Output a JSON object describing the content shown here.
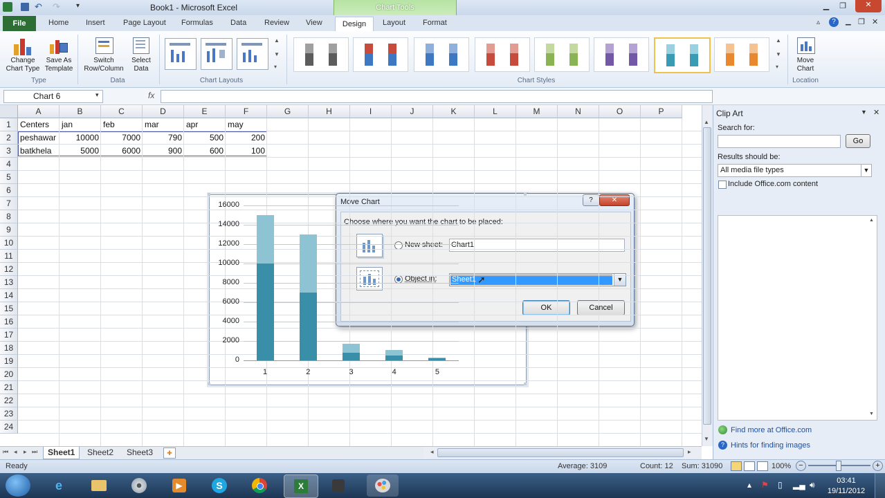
{
  "window": {
    "title": "Book1 - Microsoft Excel",
    "chart_tools_label": "Chart Tools",
    "controls": {
      "minimize": "▁",
      "maximize": "❐",
      "close": "✕"
    }
  },
  "tabs": [
    "File",
    "Home",
    "Insert",
    "Page Layout",
    "Formulas",
    "Data",
    "Review",
    "View",
    "Design",
    "Layout",
    "Format"
  ],
  "ribbon": {
    "type_group": {
      "label": "Type",
      "change_chart_type": "Change Chart Type",
      "save_as_template": "Save As Template"
    },
    "data_group": {
      "label": "Data",
      "switch_row_column": "Switch Row/Column",
      "select_data": "Select Data"
    },
    "layouts_group": {
      "label": "Chart Layouts"
    },
    "styles_group": {
      "label": "Chart Styles"
    },
    "location_group": {
      "label": "Location",
      "move_chart": "Move Chart"
    }
  },
  "formula_bar": {
    "name_box": "Chart 6",
    "fx": "fx",
    "value": ""
  },
  "columns": [
    "A",
    "B",
    "C",
    "D",
    "E",
    "F",
    "G",
    "H",
    "I",
    "J",
    "K",
    "L",
    "M",
    "N",
    "O",
    "P"
  ],
  "rows": [
    "1",
    "2",
    "3",
    "4",
    "5",
    "6",
    "7",
    "8",
    "9",
    "10",
    "11",
    "12",
    "13",
    "14",
    "15",
    "16",
    "17",
    "18",
    "19",
    "20",
    "21",
    "22",
    "23",
    "24"
  ],
  "sheet": {
    "row1": [
      "Centers",
      "jan",
      "feb",
      "mar",
      "apr",
      "may"
    ],
    "row2": [
      "peshawar",
      "10000",
      "7000",
      "790",
      "500",
      "200"
    ],
    "row3": [
      "batkhela",
      "5000",
      "6000",
      "900",
      "600",
      "100"
    ]
  },
  "chart_data": {
    "type": "bar",
    "stacked": true,
    "categories": [
      "1",
      "2",
      "3",
      "4",
      "5"
    ],
    "series": [
      {
        "values": [
          10000,
          7000,
          790,
          500,
          200
        ],
        "color": "#3a8fa8"
      },
      {
        "values": [
          5000,
          6000,
          900,
          600,
          100
        ],
        "color": "#8dc3d3"
      }
    ],
    "yticks": [
      "16000",
      "14000",
      "12000",
      "10000",
      "8000",
      "6000",
      "4000",
      "2000",
      "0"
    ],
    "ylim": [
      0,
      16000
    ],
    "grid": true,
    "title": "",
    "xlabel": "",
    "ylabel": ""
  },
  "dialog": {
    "title": "Move Chart",
    "help": "?",
    "close": "✕",
    "prompt": "Choose where you want the chart to be placed:",
    "new_sheet_label": "New sheet:",
    "new_sheet_value": "Chart1",
    "object_in_label": "Object in:",
    "object_in_value": "Sheet1",
    "selected": "object_in",
    "ok": "OK",
    "cancel": "Cancel"
  },
  "sheet_tabs": [
    "Sheet1",
    "Sheet2",
    "Sheet3"
  ],
  "active_sheet": "Sheet1",
  "status": {
    "ready": "Ready",
    "average": "Average: 3109",
    "count": "Count: 12",
    "sum": "Sum: 31090",
    "zoom": "100%"
  },
  "clip_art": {
    "title": "Clip Art",
    "search_for_label": "Search for:",
    "search_value": "",
    "go_button": "Go",
    "results_label": "Results should be:",
    "results_value": "All media file types",
    "include_office": "Include Office.com content",
    "include_checked": false,
    "find_more": "Find more at Office.com",
    "hints": "Hints for finding images"
  },
  "taskbar": {
    "time": "03:41",
    "date": "19/11/2012"
  }
}
